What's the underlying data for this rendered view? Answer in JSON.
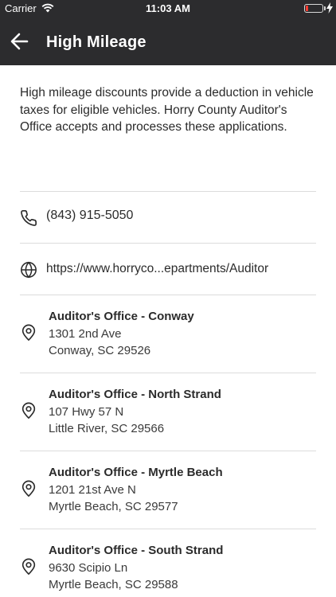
{
  "status_bar": {
    "carrier": "Carrier",
    "time": "11:03 AM",
    "battery_color": "#ff3b30"
  },
  "nav": {
    "title": "High Mileage",
    "back_icon": "arrow-left-icon",
    "background": "#2c2c2e"
  },
  "intro": "High mileage discounts provide a deduction in vehicle taxes for eligible vehicles. Horry County Auditor's Office accepts and processes these applications.",
  "contact": {
    "phone_icon": "phone-icon",
    "phone": "(843) 915-5050",
    "web_icon": "globe-icon",
    "website": "https://www.horryco...epartments/Auditor"
  },
  "offices": [
    {
      "icon": "map-pin-icon",
      "name": "Auditor's Office - Conway",
      "address": "1301 2nd Ave",
      "city": "Conway, SC 29526"
    },
    {
      "icon": "map-pin-icon",
      "name": "Auditor's Office - North Strand",
      "address": "107 Hwy 57 N",
      "city": "Little River, SC 29566"
    },
    {
      "icon": "map-pin-icon",
      "name": "Auditor's Office - Myrtle Beach",
      "address": "1201 21st Ave N",
      "city": "Myrtle Beach, SC 29577"
    },
    {
      "icon": "map-pin-icon",
      "name": "Auditor's Office - South Strand",
      "address": "9630 Scipio Ln",
      "city": "Myrtle Beach, SC 29588"
    }
  ]
}
